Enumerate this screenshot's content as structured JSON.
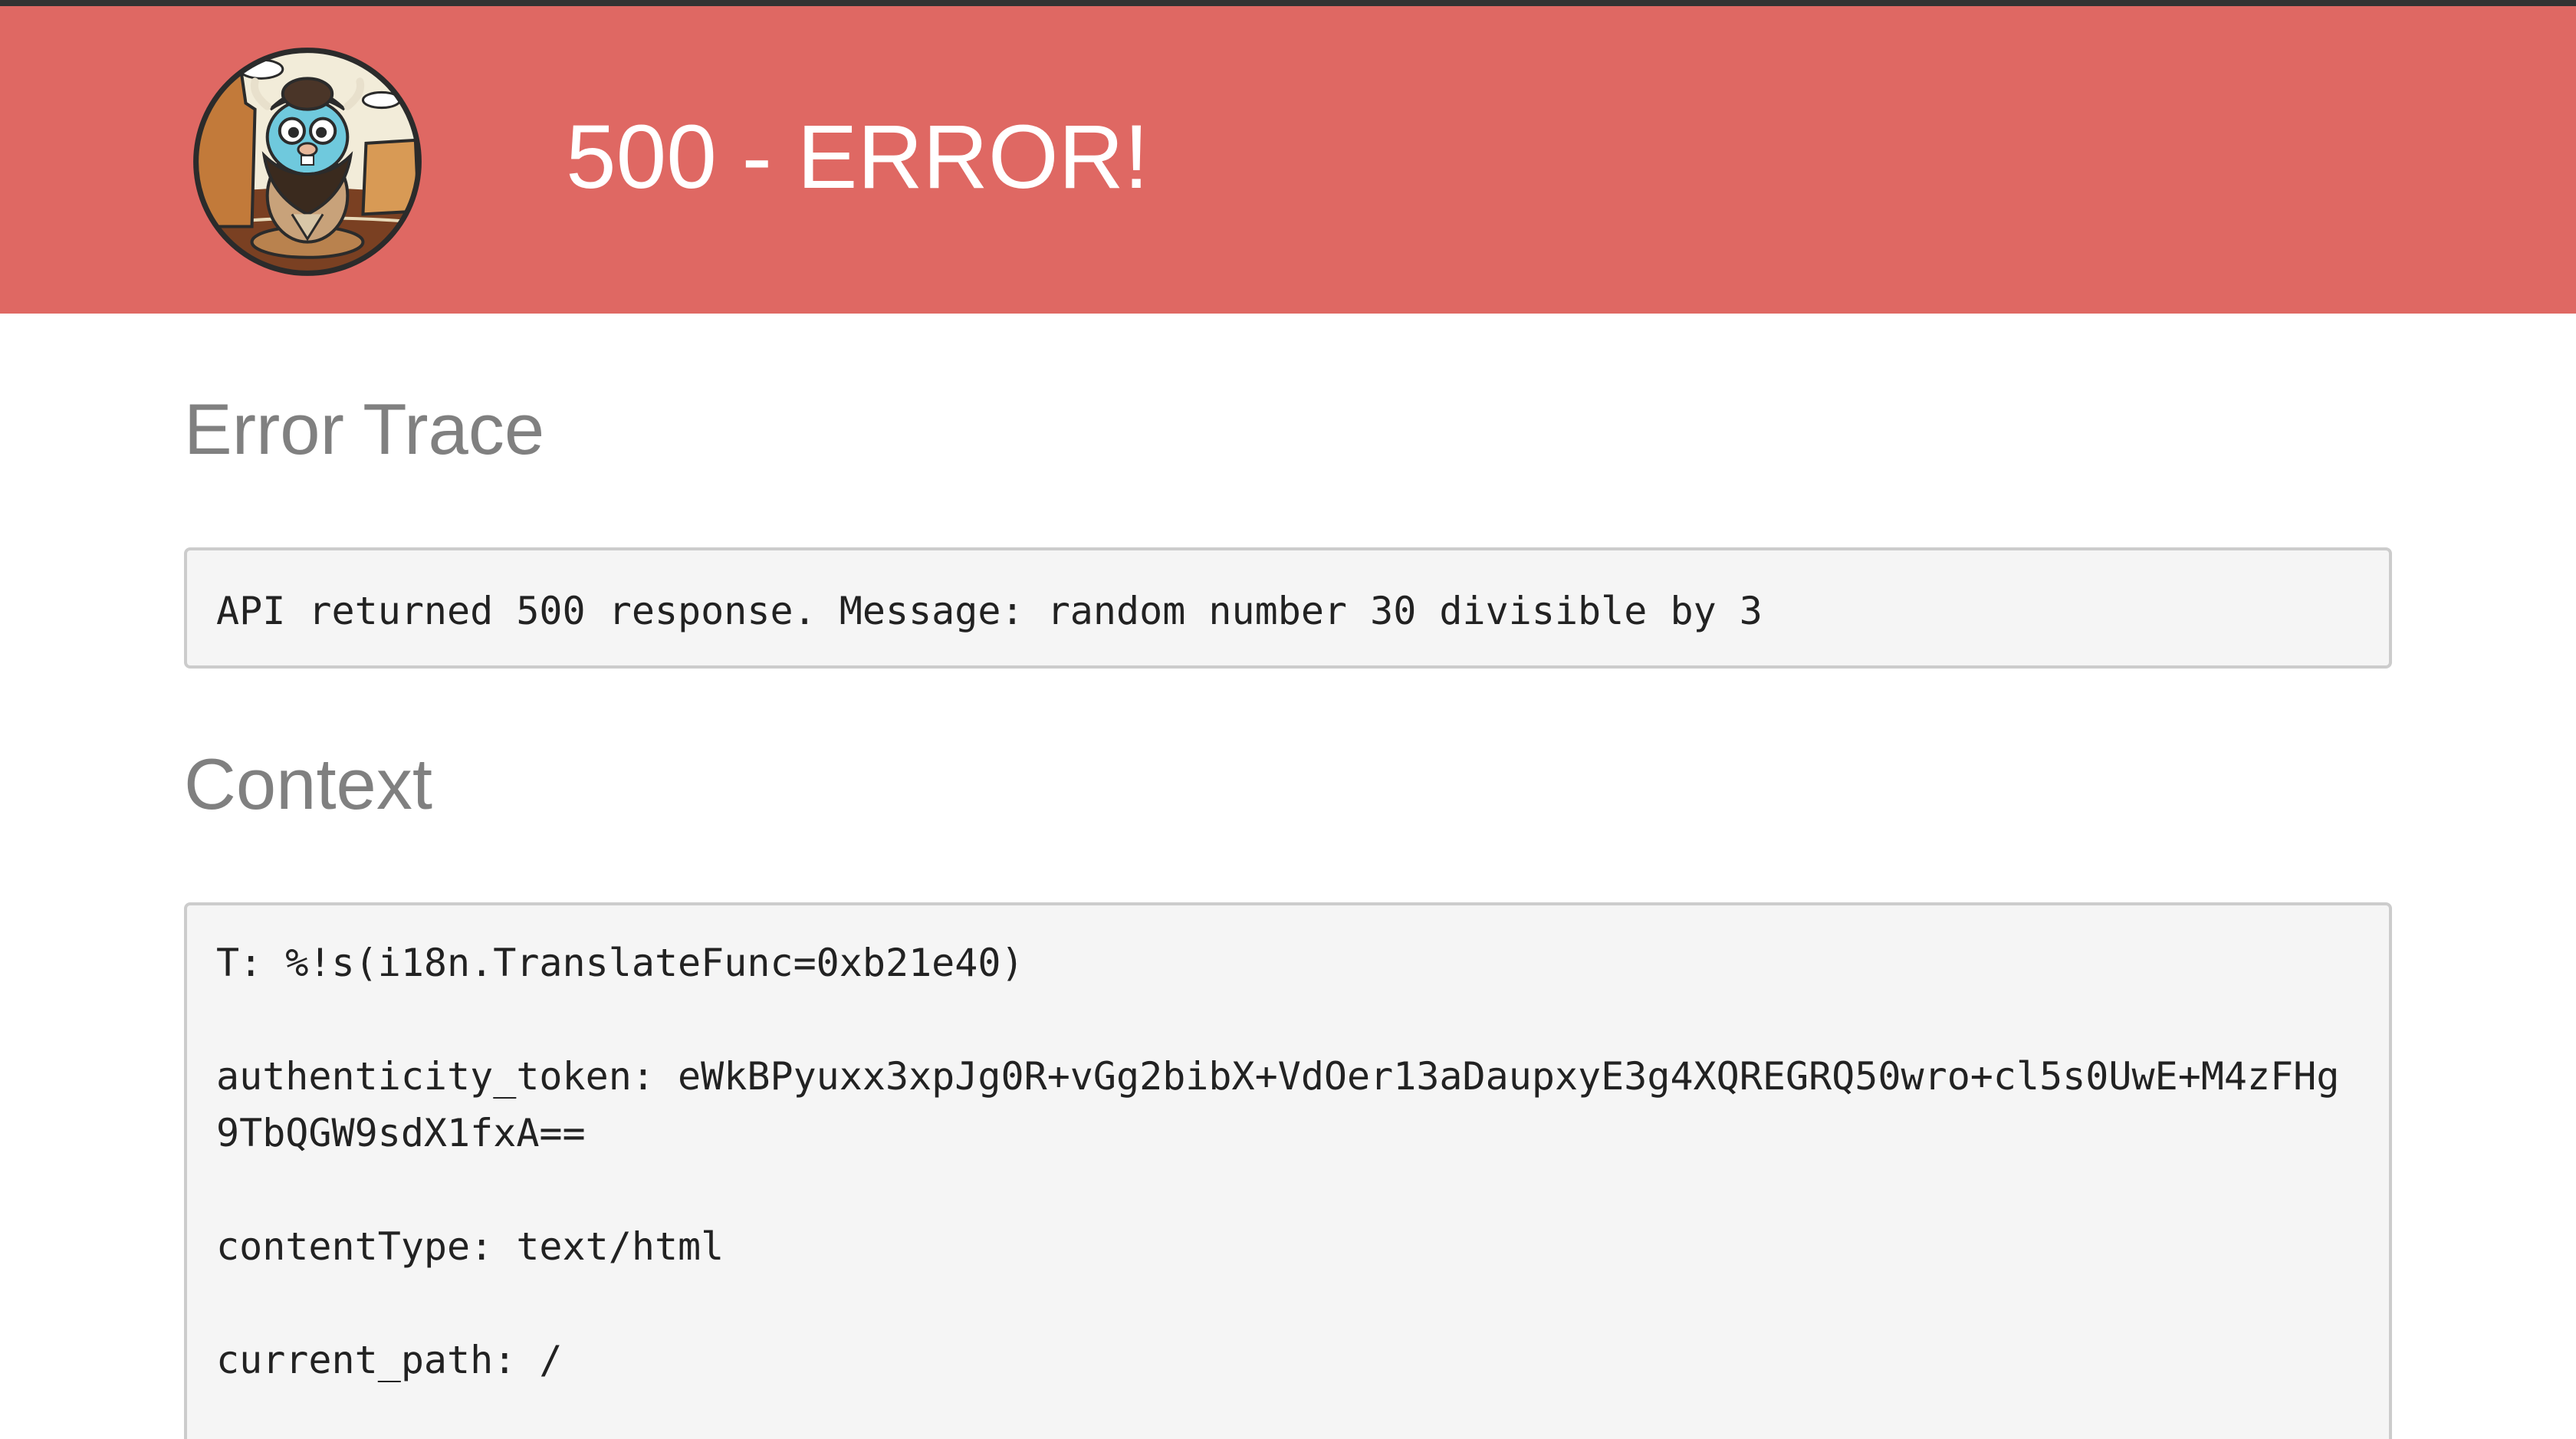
{
  "header": {
    "title": "500 - ERROR!",
    "logo_icon": "gopher-buffalo-logo-icon",
    "background_color": "#df6863"
  },
  "error_trace": {
    "heading": "Error Trace",
    "message": "API returned 500 response. Message: random number 30 divisible by 3"
  },
  "context": {
    "heading": "Context",
    "lines": [
      "T: %!s(i18n.TranslateFunc=0xb21e40)",
      "authenticity_token: eWkBPyuxx3xpJg0R+vGg2bibX+VdOer13aDaupxyE3g4XQREGRQ50wro+cl5s0UwE+M4zFHg9TbQGW9sdX1fxA==",
      "contentType: text/html",
      "current_path: /"
    ]
  }
}
